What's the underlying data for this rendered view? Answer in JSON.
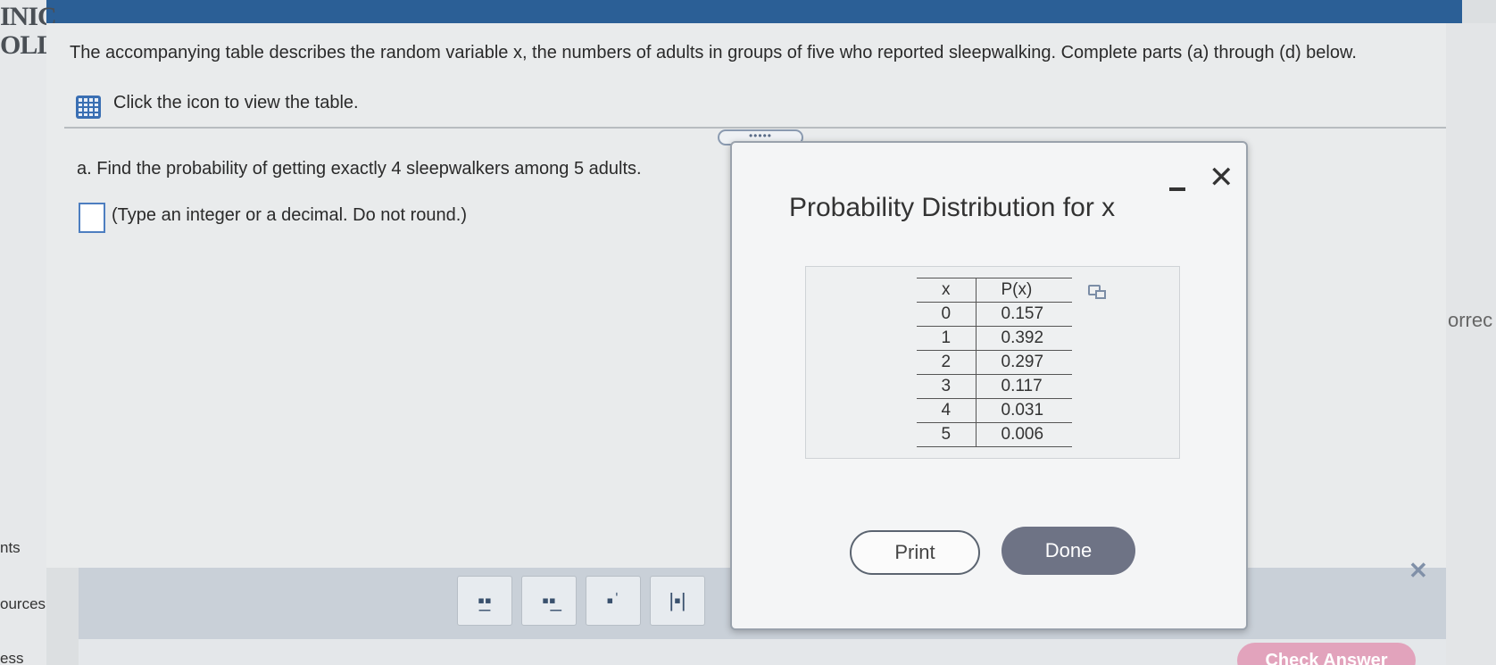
{
  "sidebar": {
    "brand_line1": "INIC",
    "brand_line2": "OLLI",
    "items": [
      "nts",
      "ources",
      "ess"
    ]
  },
  "right_clipped_text": "orrec",
  "question": {
    "intro": "The accompanying table describes the random variable x, the numbers of adults in groups of five who reported sleepwalking. Complete parts (a) through (d) below.",
    "table_link": "Click the icon to view the table.",
    "drag_handle": "•••••",
    "part_a": "a. Find the probability of getting exactly 4 sleepwalkers among 5 adults.",
    "hint": "(Type an integer or a decimal. Do not round.)",
    "answer_value": ""
  },
  "modal": {
    "title": "Probability Distribution for x",
    "close_glyph": "✕",
    "table": {
      "headers": [
        "x",
        "P(x)"
      ],
      "rows": [
        [
          "0",
          "0.157"
        ],
        [
          "1",
          "0.392"
        ],
        [
          "2",
          "0.297"
        ],
        [
          "3",
          "0.117"
        ],
        [
          "4",
          "0.031"
        ],
        [
          "5",
          "0.006"
        ]
      ]
    },
    "print_label": "Print",
    "done_label": "Done"
  },
  "toolbar": {
    "buttons": [
      {
        "icon": "fraction-icon",
        "glyph": "▪̲▪"
      },
      {
        "icon": "mixed-number-icon",
        "glyph": "▪▪̲"
      },
      {
        "icon": "exponent-icon",
        "glyph": "▪ˈ"
      },
      {
        "icon": "absolute-value-icon",
        "glyph": "|▪|"
      }
    ],
    "close_glyph": "✕",
    "check_answer": "Check Answer"
  },
  "colors": {
    "topbar": "#2b5f96",
    "done_button": "#6e7385",
    "check_answer": "#e2a3bc",
    "accent": "#3a6fb3"
  }
}
